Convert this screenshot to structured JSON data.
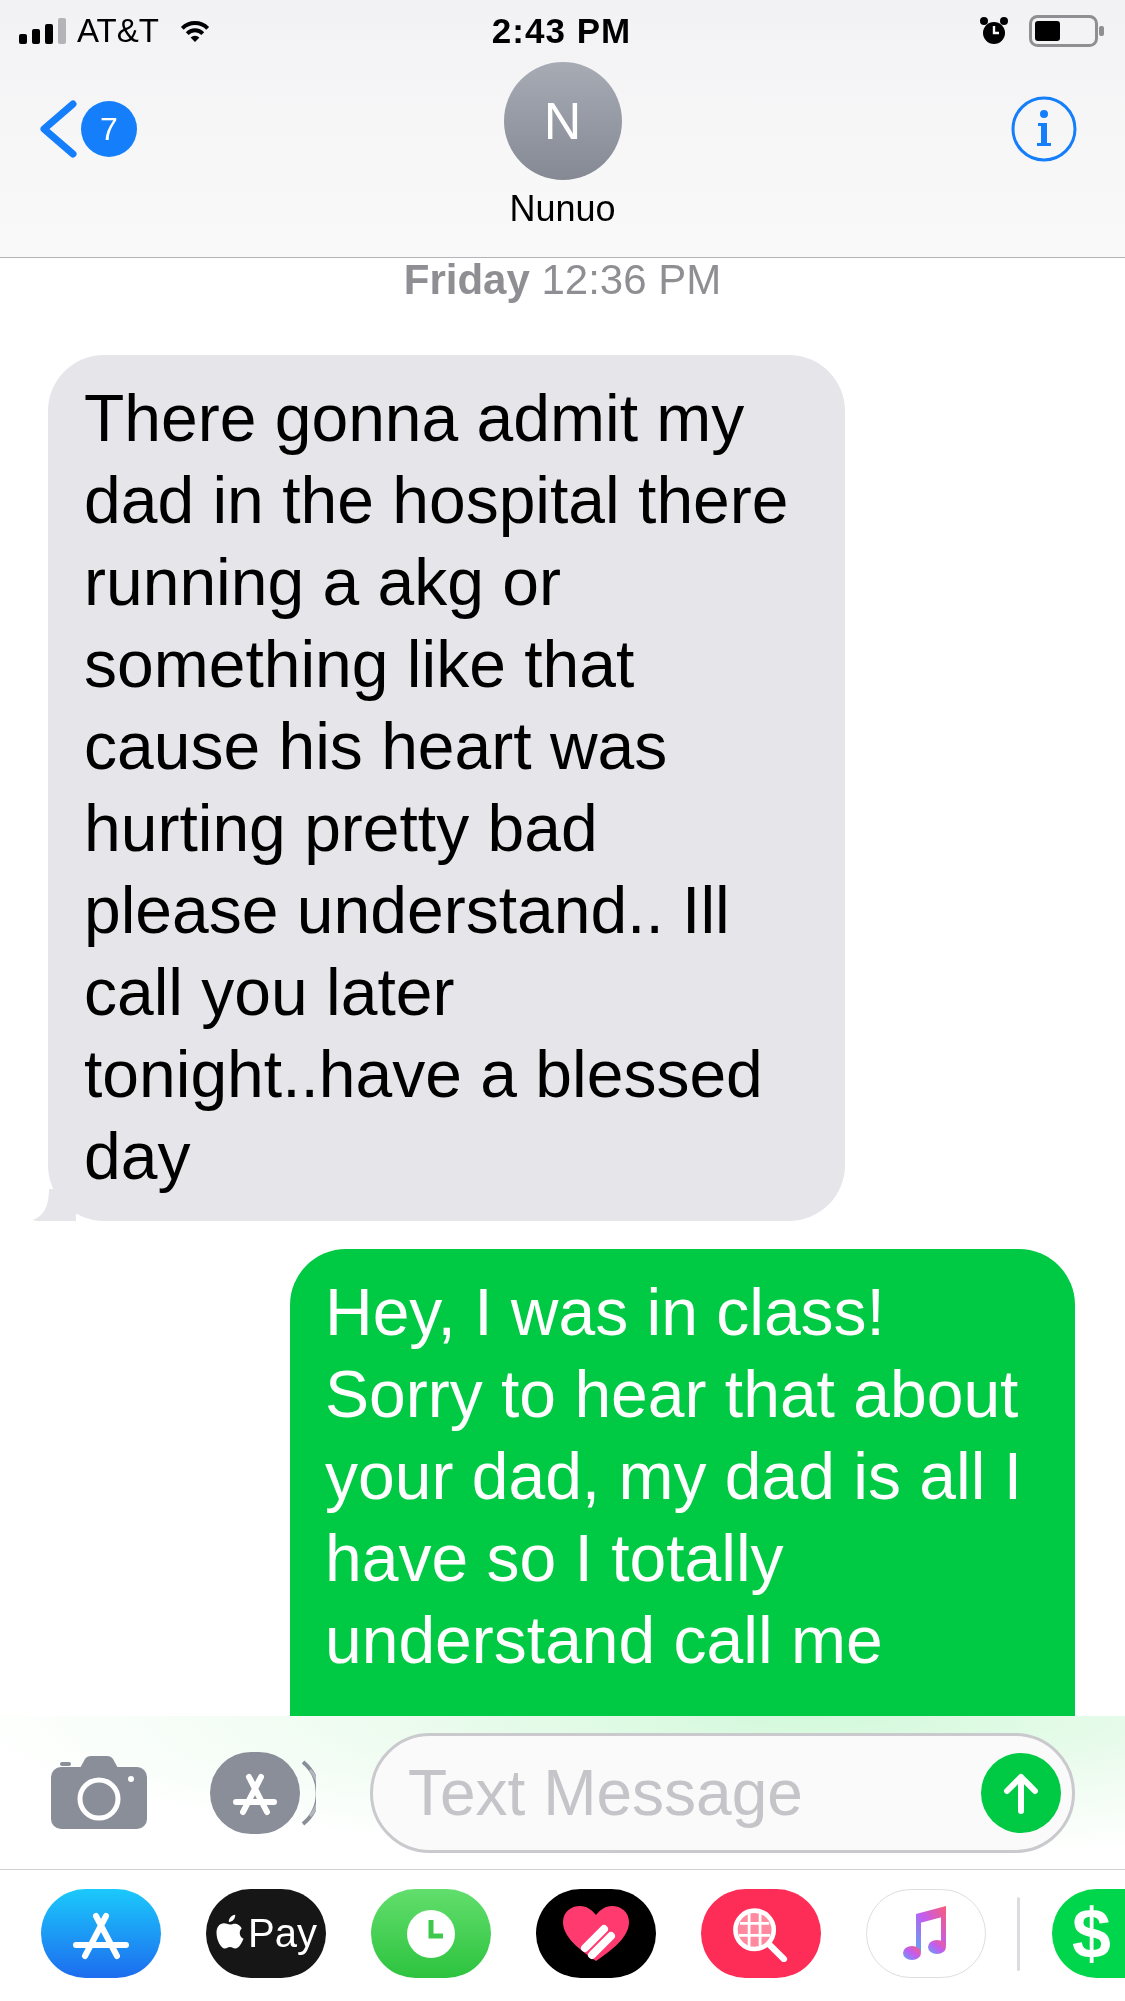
{
  "status_bar": {
    "carrier": "AT&T",
    "time": "2:43 PM"
  },
  "header": {
    "back_badge": "7",
    "contact_initial": "N",
    "contact_name": "Nunuo"
  },
  "conversation": {
    "timestamp": "**Friday** 12:36 PM",
    "messages": [
      {
        "kind": "received",
        "text": "There gonna admit my dad in the hospital there running a akg or something like that cause his heart was hurting pretty bad please understand.. Ill call you later tonight..have a blessed day"
      },
      {
        "kind": "sent",
        "text": "Hey, I was in class! Sorry to hear that about your dad, my dad is all I have so I totally understand call me"
      }
    ]
  },
  "composer": {
    "placeholder": "Text Message"
  },
  "app_drawer": {
    "apps": [
      {
        "kind": "store"
      },
      {
        "kind": "pay",
        "label": "Pay"
      },
      {
        "kind": "clock"
      },
      {
        "kind": "heart"
      },
      {
        "kind": "search"
      },
      {
        "kind": "music"
      },
      {
        "kind": "cash",
        "label": "$"
      }
    ]
  }
}
